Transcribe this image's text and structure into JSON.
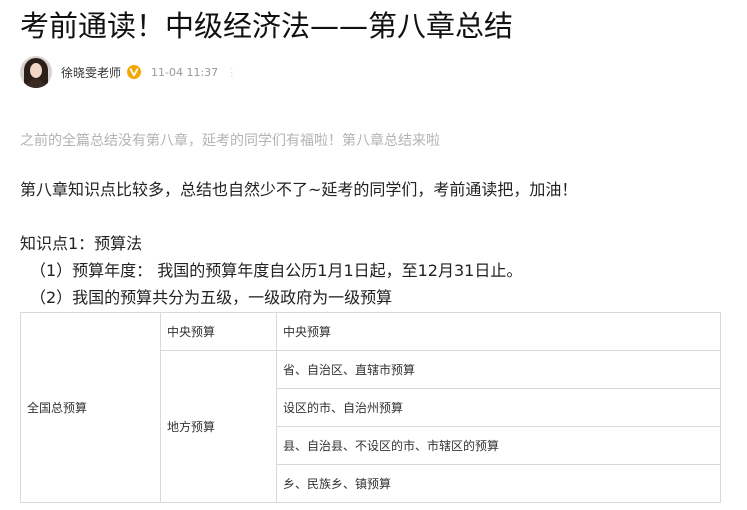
{
  "article": {
    "title": "考前通读！中级经济法——第八章总结",
    "author": {
      "name": "徐晓雯老师",
      "verified_badge": "V",
      "time": "11-04 11:37",
      "more": "⋮"
    },
    "subtitle": "之前的全篇总结没有第八章，延考的同学们有福啦！第八章总结来啦",
    "paragraphs": [
      "第八章知识点比较多，总结也自然少不了~延考的同学们，考前通读把，加油！",
      "知识点1：预算法",
      "（1）预算年度：  我国的预算年度自公历1月1日起，至12月31日止。",
      "（2）我国的预算共分为五级，一级政府为一级预算"
    ],
    "table": {
      "col1": "全国总预算",
      "central": {
        "category": "中央预算",
        "item": "中央预算"
      },
      "local": {
        "category": "地方预算",
        "items": [
          "省、自治区、直辖市预算",
          "设区的市、自治州预算",
          "县、自治县、不设区的市、市辖区的预算",
          "乡、民族乡、镇预算"
        ]
      }
    }
  },
  "colors": {
    "badge": "#f2a900",
    "subtitle": "#b3b3b3",
    "border": "#d8d8d8"
  }
}
